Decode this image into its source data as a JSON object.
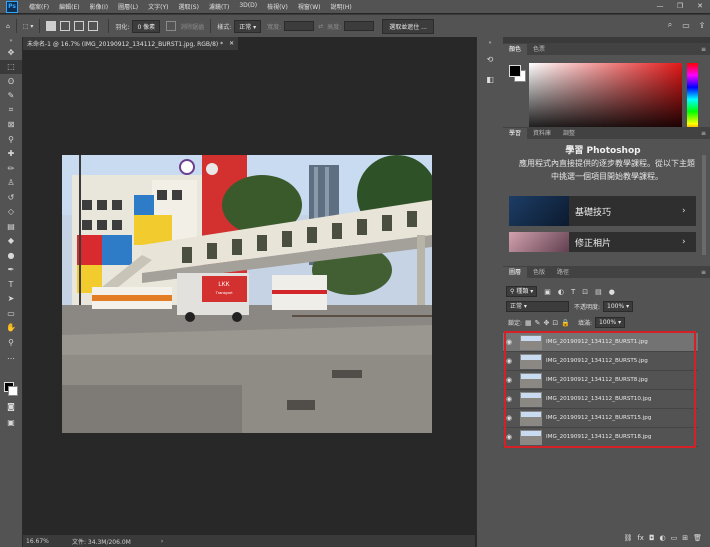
{
  "menu": [
    "檔案(F)",
    "編輯(E)",
    "影像(I)",
    "圖層(L)",
    "文字(Y)",
    "選取(S)",
    "濾鏡(T)",
    "3D(D)",
    "檢視(V)",
    "視窗(W)",
    "說明(H)"
  ],
  "window_controls": [
    "—",
    "❐",
    "✕"
  ],
  "options": {
    "feather_label": "羽化:",
    "feather_value": "0 像素",
    "antialias": "消除鋸齒",
    "style_label": "樣式:",
    "style_value": "正常",
    "width_label": "寬度:",
    "height_label": "高度:",
    "mask_button": "選取並遮住 ..."
  },
  "document": {
    "tab_title": "未命名-1 @ 16.7% (IMG_20190912_134112_BURST1.jpg, RGB/8) *",
    "zoom": "16.67%",
    "doc_size": "文件: 34.3M/206.0M"
  },
  "color_panel": {
    "tabs": [
      "顏色",
      "色票"
    ]
  },
  "learn_panel": {
    "tabs": [
      "學習",
      "資料庫",
      "調整"
    ],
    "title": "學習 Photoshop",
    "description": "應用程式內直接提供的逐步教學課程。從以下主題中挑選一個項目開始教學課程。",
    "cards": [
      "基礎技巧",
      "修正相片"
    ]
  },
  "layers_panel": {
    "tabs": [
      "圖層",
      "色版",
      "路徑"
    ],
    "kind_filter": "種類",
    "blend_mode": "正常",
    "opacity_label": "不透明度:",
    "opacity_value": "100%",
    "lock_label": "鎖定:",
    "fill_label": "填滿:",
    "fill_value": "100%",
    "layers": [
      "IMG_20190912_134112_BURST1.jpg",
      "IMG_20190912_134112_BURST5.jpg",
      "IMG_20190912_134112_BURST8.jpg",
      "IMG_20190912_134112_BURST10.jpg",
      "IMG_20190912_134112_BURST15.jpg",
      "IMG_20190912_134112_BURST18.jpg"
    ],
    "selected_layer": 0
  },
  "colors": {
    "highlight": "#d42027",
    "panel": "#535353",
    "canvas": "#282828"
  },
  "photo_sign": {
    "line1": "LKK",
    "line2": "Transport"
  }
}
